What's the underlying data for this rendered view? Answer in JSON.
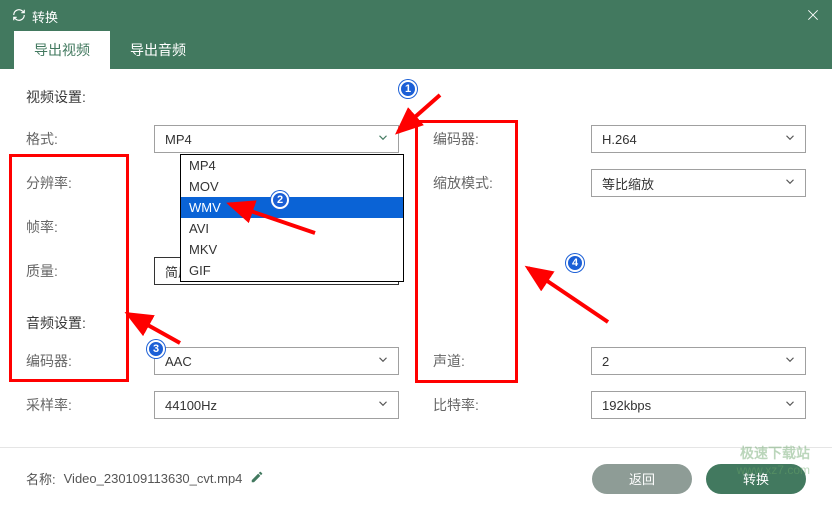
{
  "titlebar": {
    "title": "转换"
  },
  "tabs": {
    "video": "导出视频",
    "audio": "导出音频"
  },
  "sections": {
    "video_settings": "视频设置:",
    "audio_settings": "音频设置:"
  },
  "labels": {
    "format": "格式:",
    "resolution": "分辨率:",
    "framerate": "帧率:",
    "quality": "质量:",
    "encoder_v": "编码器:",
    "scale_mode": "缩放模式:",
    "encoder_a": "编码器:",
    "samplerate": "采样率:",
    "channels": "声道:",
    "bitrate": "比特率:"
  },
  "values": {
    "format": "MP4",
    "quality": "简质量",
    "encoder_v": "H.264",
    "scale_mode": "等比缩放",
    "encoder_a": "AAC",
    "samplerate": "44100Hz",
    "channels": "2",
    "bitrate": "192kbps"
  },
  "format_options": [
    "MP4",
    "MOV",
    "WMV",
    "AVI",
    "MKV",
    "GIF"
  ],
  "footer": {
    "name_label": "名称:",
    "filename": "Video_230109113630_cvt.mp4",
    "back": "返回",
    "convert": "转换"
  },
  "watermark": {
    "line1": "极速下载站",
    "line2": "www.xz7.com"
  },
  "annotations": {
    "b1": "1",
    "b2": "2",
    "b3": "3",
    "b4": "4"
  }
}
